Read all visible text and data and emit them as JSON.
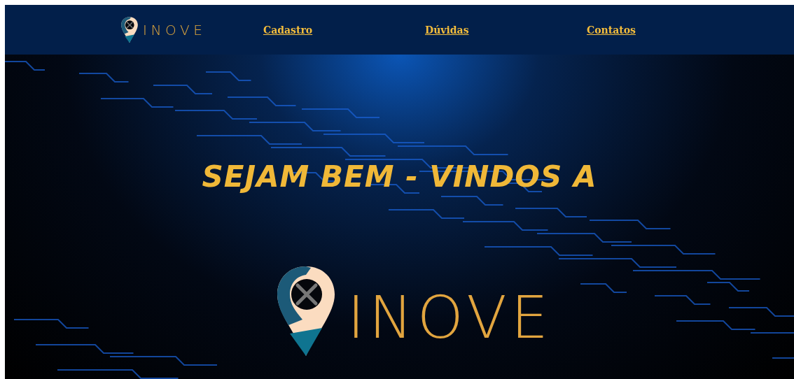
{
  "nav": {
    "logo_text": "INOVE",
    "links": [
      "Cadastro",
      "Dúvidas",
      "Contatos"
    ]
  },
  "hero": {
    "heading": "SEJAM BEM - VINDOS A",
    "logo_text": "INOVE"
  }
}
